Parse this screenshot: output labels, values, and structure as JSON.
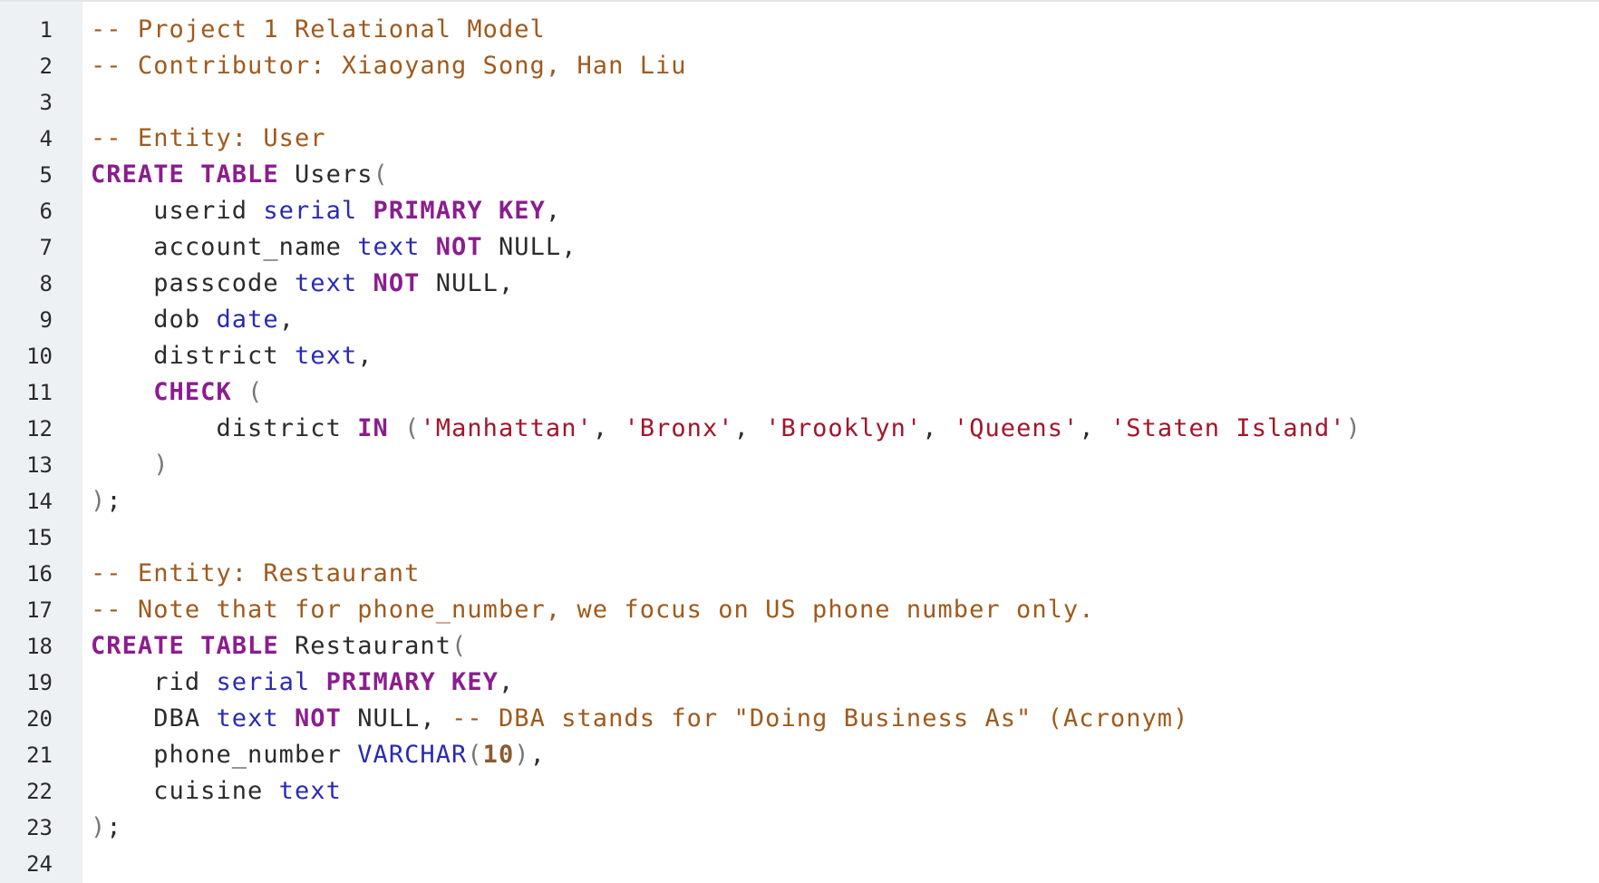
{
  "editor": {
    "colors": {
      "comment": "#a05a1c",
      "keyword": "#8b1d8f",
      "type": "#2a2ab3",
      "string": "#a3152b",
      "number": "#8a5a2e",
      "plain": "#2b2b2b",
      "gutter_bg": "#eef1f4"
    },
    "lines": [
      [
        {
          "t": "comment",
          "v": "-- Project 1 Relational Model"
        }
      ],
      [
        {
          "t": "comment",
          "v": "-- Contributor: Xiaoyang Song, Han Liu"
        }
      ],
      [],
      [
        {
          "t": "comment",
          "v": "-- Entity: User"
        }
      ],
      [
        {
          "t": "keyword",
          "v": "CREATE TABLE"
        },
        {
          "t": "plain",
          "v": " Users"
        },
        {
          "t": "punct",
          "v": "("
        }
      ],
      [
        {
          "t": "plain",
          "v": "    userid "
        },
        {
          "t": "type",
          "v": "serial"
        },
        {
          "t": "plain",
          "v": " "
        },
        {
          "t": "keyword",
          "v": "PRIMARY KEY"
        },
        {
          "t": "plain",
          "v": ","
        }
      ],
      [
        {
          "t": "plain",
          "v": "    account_name "
        },
        {
          "t": "type",
          "v": "text"
        },
        {
          "t": "plain",
          "v": " "
        },
        {
          "t": "keyword",
          "v": "NOT"
        },
        {
          "t": "plain",
          "v": " NULL,"
        }
      ],
      [
        {
          "t": "plain",
          "v": "    passcode "
        },
        {
          "t": "type",
          "v": "text"
        },
        {
          "t": "plain",
          "v": " "
        },
        {
          "t": "keyword",
          "v": "NOT"
        },
        {
          "t": "plain",
          "v": " NULL,"
        }
      ],
      [
        {
          "t": "plain",
          "v": "    dob "
        },
        {
          "t": "type",
          "v": "date"
        },
        {
          "t": "plain",
          "v": ","
        }
      ],
      [
        {
          "t": "plain",
          "v": "    district "
        },
        {
          "t": "type",
          "v": "text"
        },
        {
          "t": "plain",
          "v": ","
        }
      ],
      [
        {
          "t": "plain",
          "v": "    "
        },
        {
          "t": "keyword",
          "v": "CHECK"
        },
        {
          "t": "plain",
          "v": " "
        },
        {
          "t": "punct",
          "v": "("
        }
      ],
      [
        {
          "t": "plain",
          "v": "        district "
        },
        {
          "t": "keyword",
          "v": "IN"
        },
        {
          "t": "plain",
          "v": " "
        },
        {
          "t": "punct",
          "v": "("
        },
        {
          "t": "string",
          "v": "'Manhattan'"
        },
        {
          "t": "plain",
          "v": ", "
        },
        {
          "t": "string",
          "v": "'Bronx'"
        },
        {
          "t": "plain",
          "v": ", "
        },
        {
          "t": "string",
          "v": "'Brooklyn'"
        },
        {
          "t": "plain",
          "v": ", "
        },
        {
          "t": "string",
          "v": "'Queens'"
        },
        {
          "t": "plain",
          "v": ", "
        },
        {
          "t": "string",
          "v": "'Staten Island'"
        },
        {
          "t": "punct",
          "v": ")"
        }
      ],
      [
        {
          "t": "plain",
          "v": "    "
        },
        {
          "t": "punct",
          "v": ")"
        }
      ],
      [
        {
          "t": "punct",
          "v": ")"
        },
        {
          "t": "plain",
          "v": ";"
        }
      ],
      [],
      [
        {
          "t": "comment",
          "v": "-- Entity: Restaurant"
        }
      ],
      [
        {
          "t": "comment",
          "v": "-- Note that for phone_number, we focus on US phone number only."
        }
      ],
      [
        {
          "t": "keyword",
          "v": "CREATE TABLE"
        },
        {
          "t": "plain",
          "v": " Restaurant"
        },
        {
          "t": "punct",
          "v": "("
        }
      ],
      [
        {
          "t": "plain",
          "v": "    rid "
        },
        {
          "t": "type",
          "v": "serial"
        },
        {
          "t": "plain",
          "v": " "
        },
        {
          "t": "keyword",
          "v": "PRIMARY KEY"
        },
        {
          "t": "plain",
          "v": ","
        }
      ],
      [
        {
          "t": "plain",
          "v": "    DBA "
        },
        {
          "t": "type",
          "v": "text"
        },
        {
          "t": "plain",
          "v": " "
        },
        {
          "t": "keyword",
          "v": "NOT"
        },
        {
          "t": "plain",
          "v": " NULL, "
        },
        {
          "t": "comment",
          "v": "-- DBA stands for \"Doing Business As\" (Acronym)"
        }
      ],
      [
        {
          "t": "plain",
          "v": "    phone_number "
        },
        {
          "t": "type",
          "v": "VARCHAR"
        },
        {
          "t": "punct",
          "v": "("
        },
        {
          "t": "number",
          "v": "10"
        },
        {
          "t": "punct",
          "v": ")"
        },
        {
          "t": "plain",
          "v": ","
        }
      ],
      [
        {
          "t": "plain",
          "v": "    cuisine "
        },
        {
          "t": "type",
          "v": "text"
        }
      ],
      [
        {
          "t": "punct",
          "v": ")"
        },
        {
          "t": "plain",
          "v": ";"
        }
      ],
      []
    ]
  }
}
